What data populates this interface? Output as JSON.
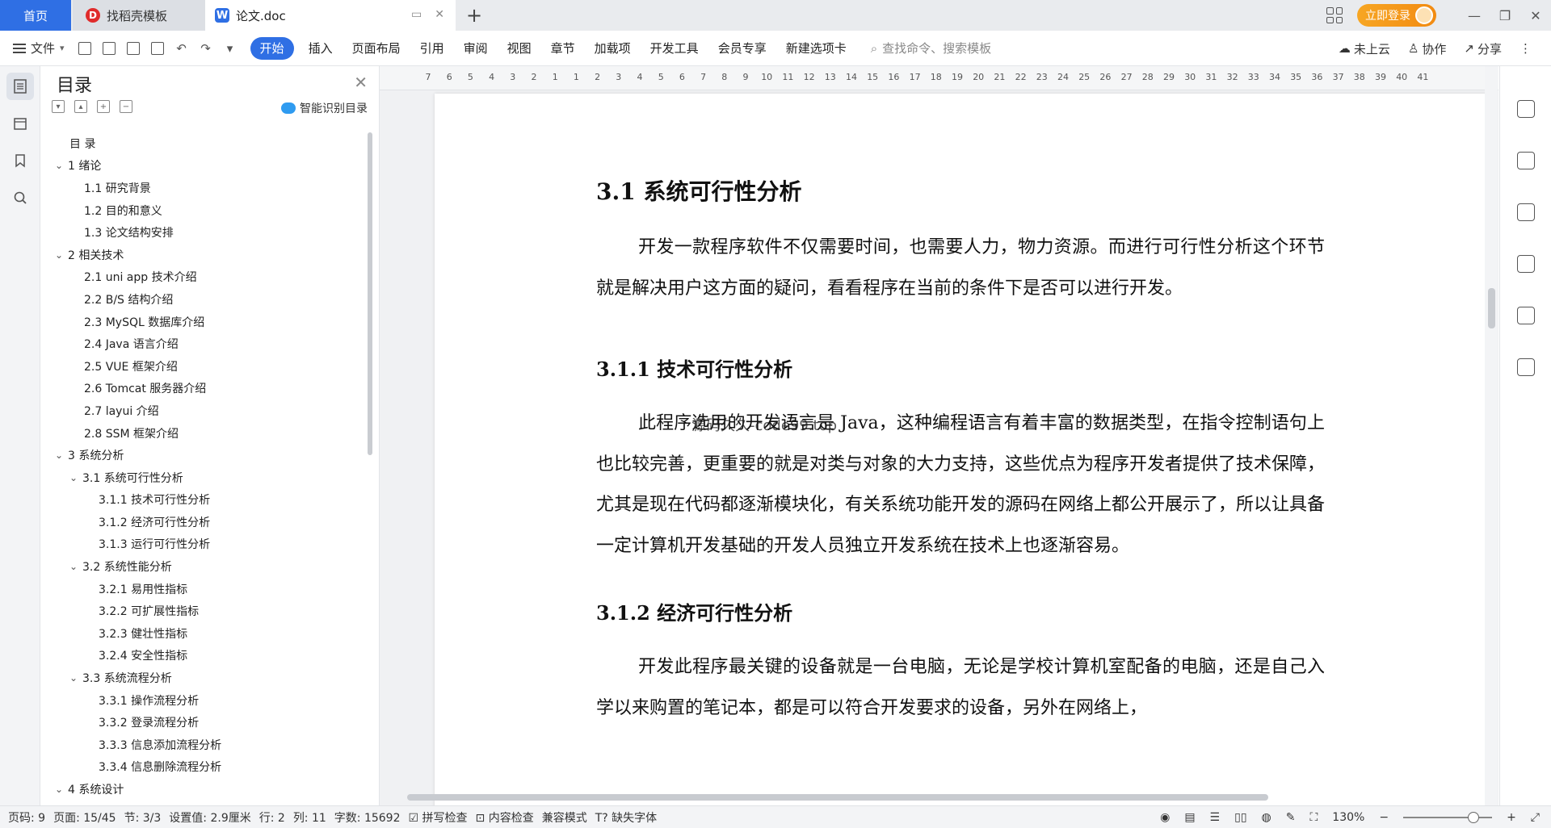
{
  "tabs": {
    "home": "首页",
    "templates": "找稻壳模板",
    "document": "论文.doc"
  },
  "header": {
    "login": "立即登录"
  },
  "ribbon": {
    "file": "文件",
    "tabs": [
      "开始",
      "插入",
      "页面布局",
      "引用",
      "审阅",
      "视图",
      "章节",
      "加载项",
      "开发工具",
      "会员专享",
      "新建选项卡"
    ],
    "search_placeholder": "查找命令、搜索模板",
    "cloud": "未上云",
    "collab": "协作",
    "share": "分享"
  },
  "toc": {
    "title": "目录",
    "smart_button": "智能识别目录",
    "items": [
      {
        "label": "目 录",
        "level": 0,
        "expandable": false
      },
      {
        "label": "1 绪论",
        "level": 1,
        "expandable": true
      },
      {
        "label": "1.1  研究背景",
        "level": 2,
        "expandable": false
      },
      {
        "label": "1.2  目的和意义",
        "level": 2,
        "expandable": false
      },
      {
        "label": "1.3  论文结构安排",
        "level": 2,
        "expandable": false
      },
      {
        "label": "2 相关技术",
        "level": 1,
        "expandable": true
      },
      {
        "label": "2.1 uni app 技术介绍",
        "level": 2,
        "expandable": false
      },
      {
        "label": "2.2 B/S 结构介绍",
        "level": 2,
        "expandable": false
      },
      {
        "label": "2.3 MySQL 数据库介绍",
        "level": 2,
        "expandable": false
      },
      {
        "label": "2.4 Java 语言介绍",
        "level": 2,
        "expandable": false
      },
      {
        "label": "2.5 VUE 框架介绍",
        "level": 2,
        "expandable": false
      },
      {
        "label": "2.6 Tomcat 服务器介绍",
        "level": 2,
        "expandable": false
      },
      {
        "label": "2.7 layui 介绍",
        "level": 2,
        "expandable": false
      },
      {
        "label": "2.8 SSM 框架介绍",
        "level": 2,
        "expandable": false
      },
      {
        "label": "3 系统分析",
        "level": 1,
        "expandable": true
      },
      {
        "label": "3.1  系统可行性分析",
        "level": 2,
        "expandable": true
      },
      {
        "label": "3.1.1  技术可行性分析",
        "level": 3,
        "expandable": false
      },
      {
        "label": "3.1.2  经济可行性分析",
        "level": 3,
        "expandable": false
      },
      {
        "label": "3.1.3  运行可行性分析",
        "level": 3,
        "expandable": false
      },
      {
        "label": "3.2  系统性能分析",
        "level": 2,
        "expandable": true
      },
      {
        "label": "3.2.1  易用性指标",
        "level": 3,
        "expandable": false
      },
      {
        "label": "3.2.2  可扩展性指标",
        "level": 3,
        "expandable": false
      },
      {
        "label": "3.2.3  健壮性指标",
        "level": 3,
        "expandable": false
      },
      {
        "label": "3.2.4  安全性指标",
        "level": 3,
        "expandable": false
      },
      {
        "label": "3.3  系统流程分析",
        "level": 2,
        "expandable": true
      },
      {
        "label": "3.3.1  操作流程分析",
        "level": 3,
        "expandable": false
      },
      {
        "label": "3.3.2  登录流程分析",
        "level": 3,
        "expandable": false
      },
      {
        "label": "3.3.3  信息添加流程分析",
        "level": 3,
        "expandable": false
      },
      {
        "label": "3.3.4  信息删除流程分析",
        "level": 3,
        "expandable": false
      },
      {
        "label": "4 系统设计",
        "level": 1,
        "expandable": true
      }
    ]
  },
  "ruler": {
    "numbers": [
      "7",
      "6",
      "5",
      "4",
      "3",
      "2",
      "1",
      "1",
      "2",
      "3",
      "4",
      "5",
      "6",
      "7",
      "8",
      "9",
      "10",
      "11",
      "12",
      "13",
      "14",
      "15",
      "16",
      "17",
      "18",
      "19",
      "20",
      "21",
      "22",
      "23",
      "24",
      "25",
      "26",
      "27",
      "28",
      "29",
      "30",
      "31",
      "32",
      "33",
      "34",
      "35",
      "36",
      "37",
      "38",
      "39",
      "40",
      "41"
    ]
  },
  "document": {
    "section_title": "3.1  系统可行性分析",
    "para1": "开发一款程序软件不仅需要时间，也需要人力，物力资源。而进行可行性分析这个环节就是解决用户这方面的疑问，看看程序在当前的条件下是否可以进行开发。",
    "sub1_title": "3.1.1  技术可行性分析",
    "watermark": "源码久久-code99.top",
    "para2": "此程序选用的开发语言是 Java，这种编程语言有着丰富的数据类型，在指令控制语句上也比较完善，更重要的就是对类与对象的大力支持，这些优点为程序开发者提供了技术保障，尤其是现在代码都逐渐模块化，有关系统功能开发的源码在网络上都公开展示了，所以让具备一定计算机开发基础的开发人员独立开发系统在技术上也逐渐容易。",
    "sub2_title": "3.1.2  经济可行性分析",
    "para3": "开发此程序最关键的设备就是一台电脑，无论是学校计算机室配备的电脑，还是自己入学以来购置的笔记本，都是可以符合开发要求的设备，另外在网络上，"
  },
  "status": {
    "page_code": "页码: 9",
    "page": "页面: 15/45",
    "section": "节: 3/3",
    "setting": "设置值: 2.9厘米",
    "row": "行: 2",
    "col": "列: 11",
    "word_count": "字数: 15692",
    "spell": "拼写检查",
    "content_check": "内容检查",
    "compat": "兼容模式",
    "missing_font": "缺失字体",
    "zoom": "130%"
  }
}
